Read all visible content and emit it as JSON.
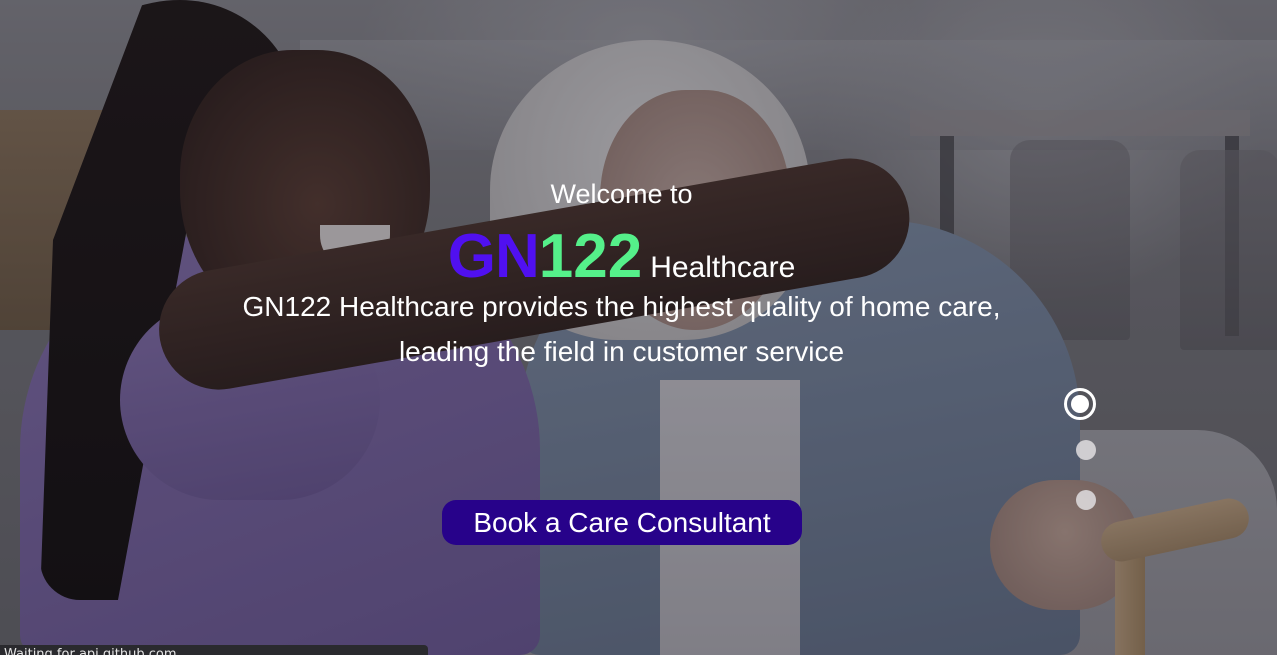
{
  "hero": {
    "welcome_text": "Welcome to",
    "brand_part1": "GN",
    "brand_part2": "122",
    "brand_part3": "Healthcare",
    "tagline": "GN122 Healthcare provides the highest quality of home care, leading the field in customer service",
    "cta_label": "Book a Care Consultant"
  },
  "slider": {
    "active_index": 0,
    "dot_count": 3
  },
  "status_bar": {
    "text": "Waiting for api.github.com..."
  },
  "colors": {
    "brand_gn": "#5010f0",
    "brand_num": "#55f08a",
    "cta_background": "#27028a"
  }
}
